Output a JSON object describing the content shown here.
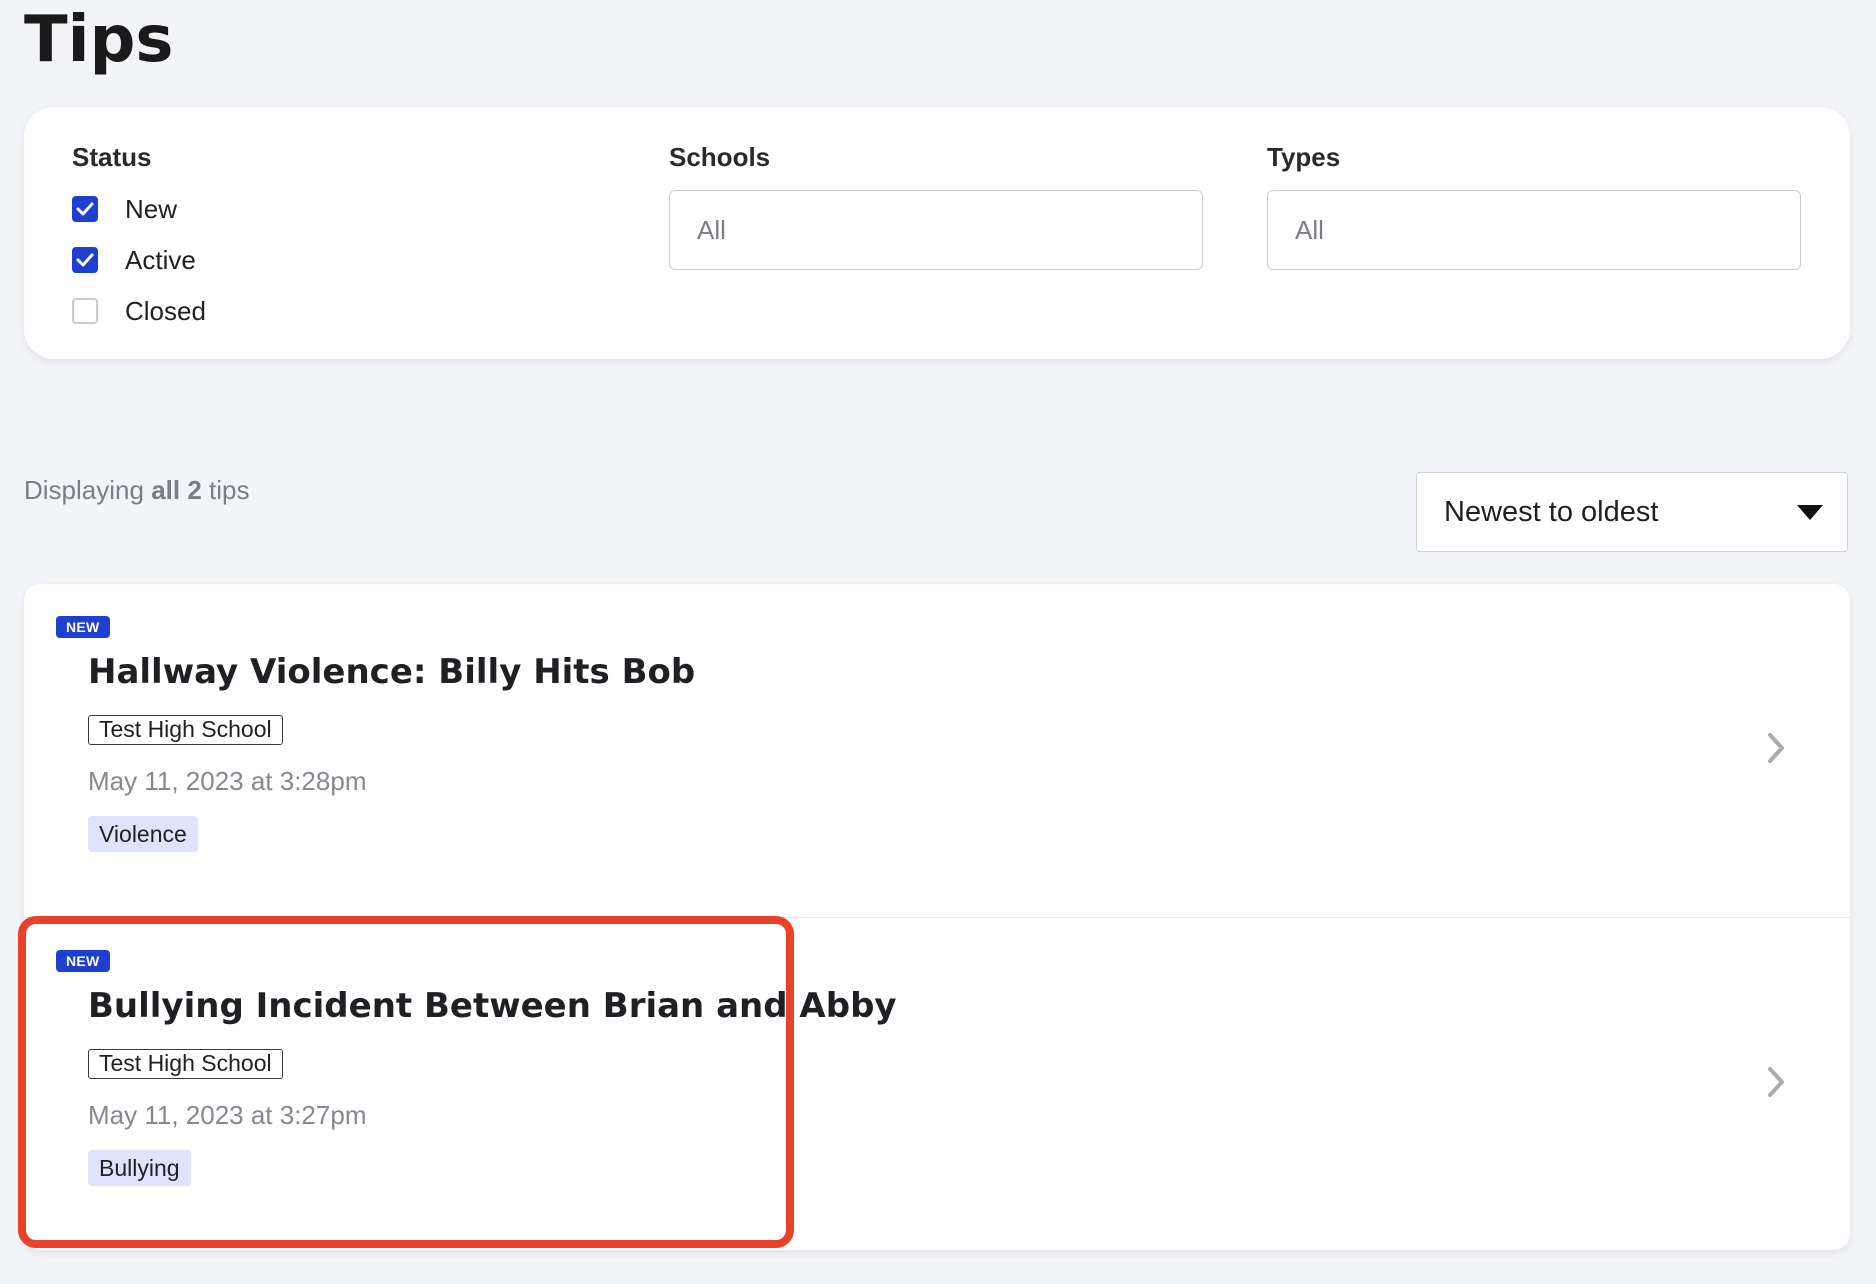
{
  "page": {
    "title": "Tips"
  },
  "filters": {
    "status": {
      "label": "Status",
      "options": [
        {
          "label": "New",
          "checked": true
        },
        {
          "label": "Active",
          "checked": true
        },
        {
          "label": "Closed",
          "checked": false
        }
      ]
    },
    "schools": {
      "label": "Schools",
      "value": "All"
    },
    "types": {
      "label": "Types",
      "value": "All"
    }
  },
  "results": {
    "prefix": "Displaying",
    "count_text": "all 2",
    "suffix": "tips"
  },
  "sort": {
    "selected": "Newest to oldest"
  },
  "tips": [
    {
      "badge": "NEW",
      "title": "Hallway Violence: Billy Hits Bob",
      "school": "Test High School",
      "date": "May 11, 2023 at 3:28pm",
      "type": "Violence"
    },
    {
      "badge": "NEW",
      "title": "Bullying Incident Between Brian and Abby",
      "school": "Test High School",
      "date": "May 11, 2023 at 3:27pm",
      "type": "Bullying"
    }
  ],
  "colors": {
    "accent": "#1e3fd0",
    "type_tag_bg": "#dde4fb",
    "highlight": "#e8422a",
    "background": "#f3f4f8"
  }
}
